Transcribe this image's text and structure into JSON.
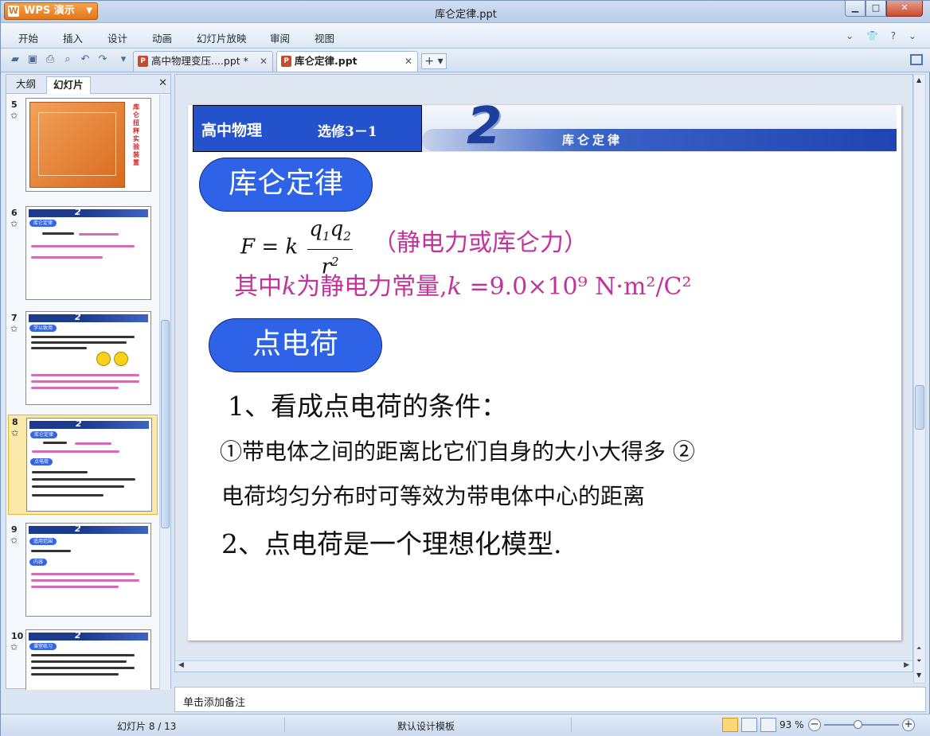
{
  "app": {
    "menu_button": "WPS 演示",
    "window_title": "库仑定律.ppt",
    "minimize": "▁",
    "maximize": "□",
    "close": "✕"
  },
  "menu": {
    "items": [
      "开始",
      "插入",
      "设计",
      "动画",
      "幻灯片放映",
      "审阅",
      "视图"
    ],
    "right_icons": "⌄ 👕 ? ⌄"
  },
  "tabs": [
    {
      "label": "高中物理变压....ppt *",
      "active": false
    },
    {
      "label": "库仑定律.ppt",
      "active": true
    }
  ],
  "tab_add": "+ ▾",
  "left_panel": {
    "tab_outline": "大纲",
    "tab_slides": "幻灯片",
    "close": "✕",
    "thumbnails": [
      {
        "number": "5",
        "star": "✩",
        "vertical_text": "库仑扭秤实验装置"
      },
      {
        "number": "6",
        "star": "✩",
        "pill": "库仑定律"
      },
      {
        "number": "7",
        "star": "✩",
        "pill": "学以致用"
      },
      {
        "number": "8",
        "star": "✩",
        "pill": "库仑定律",
        "pill2": "点电荷",
        "selected": true
      },
      {
        "number": "9",
        "star": "✩",
        "pill": "适用范围",
        "pill2": "内容"
      },
      {
        "number": "10",
        "star": "✩",
        "pill": "课堂练习"
      }
    ]
  },
  "slide": {
    "header_title": "高中物理",
    "header_subtitle": "选修3－1",
    "banner_number": "2",
    "banner_text": "库仑定律",
    "law_pill": "库仑定律",
    "formula_lhs": "F",
    "formula_eq": "= k",
    "formula_num": "q",
    "formula_num_sub1": "1",
    "formula_num2": "q",
    "formula_num_sub2": "2",
    "formula_den": "r",
    "formula_den_sup": "2",
    "formula_note": "（静电力或库仑力）",
    "const_prefix": "其中",
    "const_k": "k",
    "const_mid": "为静电力常量,",
    "const_k2": "k",
    "const_value": " =9.0×10⁹ N·m²/C²",
    "charge_pill": "点电荷",
    "line_1": "1、看成点电荷的条件：",
    "line_2": "①带电体之间的距离比它们自身的大小大得多 ②",
    "line_3": "电荷均匀分布时可等效为带电体中心的距离",
    "line_4": "2、点电荷是一个理想化模型."
  },
  "notes_placeholder": "单击添加备注",
  "status": {
    "slide_indicator": "幻灯片 8 / 13",
    "template": "默认设计模板",
    "zoom": "93 %",
    "zoom_level_fraction": 0.45
  }
}
